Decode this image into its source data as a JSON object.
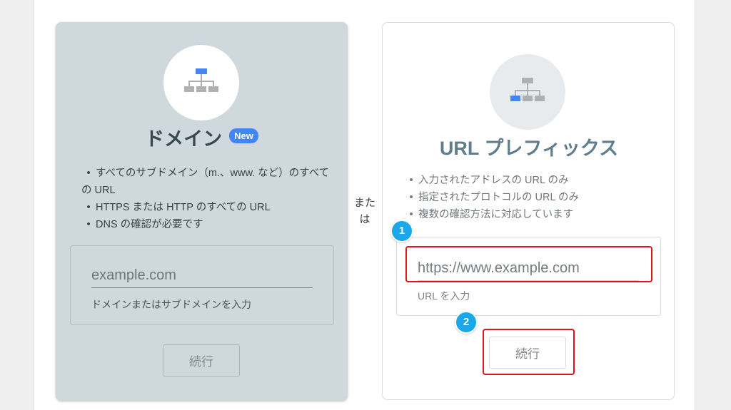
{
  "colors": {
    "left_card_bg": "#cfd8dc",
    "accent_blue": "#4285f4",
    "highlight_red": "#e0141e",
    "step_badge_blue": "#1aa8e8"
  },
  "domain_card": {
    "icon": "sitemap-icon",
    "title": "ドメイン",
    "badge": "New",
    "bullets": [
      "すべてのサブドメイン（m.、www. など）のすべての URL",
      "HTTPS または HTTP のすべての URL",
      "DNS の確認が必要です"
    ],
    "input_placeholder": "example.com",
    "input_hint": "ドメインまたはサブドメインを入力",
    "button_label": "続行"
  },
  "separator": {
    "line1": "また",
    "line2": "は"
  },
  "url_prefix_card": {
    "icon": "sitemap-icon",
    "title": "URL プレフィックス",
    "bullets": [
      "入力されたアドレスの URL のみ",
      "指定されたプロトコルの URL のみ",
      "複数の確認方法に対応しています"
    ],
    "input_placeholder": "https://www.example.com",
    "input_hint": "URL を入力",
    "button_label": "続行"
  },
  "annotations": {
    "step1": "1",
    "step2": "2"
  }
}
